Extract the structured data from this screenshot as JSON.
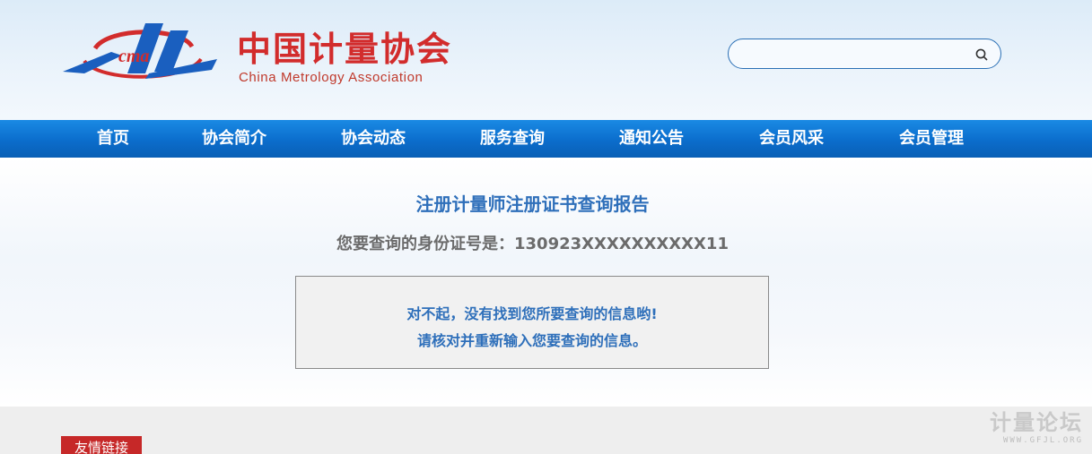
{
  "header": {
    "logo_cn": "中国计量协会",
    "logo_en": "China Metrology Association",
    "logo_mark_text": "cma",
    "search": {
      "value": "",
      "placeholder": ""
    }
  },
  "nav": {
    "items": [
      {
        "label": "首页"
      },
      {
        "label": "协会简介"
      },
      {
        "label": "协会动态"
      },
      {
        "label": "服务查询"
      },
      {
        "label": "通知公告"
      },
      {
        "label": "会员风采"
      },
      {
        "label": "会员管理"
      }
    ]
  },
  "report": {
    "title": "注册计量师注册证书查询报告",
    "id_line": "您要查询的身份证号是：130923XXXXXXXXXX11",
    "notice_line1": "对不起，没有找到您所要查询的信息哟!",
    "notice_line2": "请核对并重新输入您要查询的信息。"
  },
  "footer": {
    "friend_links": "友情链接"
  },
  "watermark": {
    "cn": "计量论坛",
    "en": "WWW.GFJL.ORG"
  },
  "colors": {
    "nav_blue": "#0b6dcc",
    "brand_red": "#d22c2c",
    "text_blue": "#2e6fba",
    "tab_red": "#c62828"
  }
}
